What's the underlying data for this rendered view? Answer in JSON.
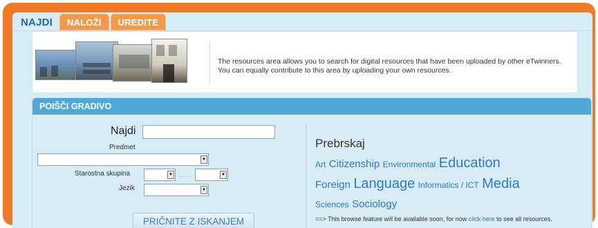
{
  "tabs": [
    {
      "label": "NAJDI",
      "active": true
    },
    {
      "label": "NALOŽI",
      "active": false
    },
    {
      "label": "UREDITE",
      "active": false
    }
  ],
  "info": {
    "line1": "The resources area allows you to search for digital resources that have been uploaded by other eTwinners.",
    "line2": "You can equally contribute to this area by uploading your own resources."
  },
  "search_panel": {
    "title": "POIŠČI GRADIVO",
    "find_label": "Najdi",
    "subject_label": "Predmet",
    "age_group_label": "Starostna skupina",
    "age_separator": ".....",
    "language_label": "Jezik",
    "search_button": "PRIČNITE Z ISKANJEM"
  },
  "browse": {
    "title": "Prebrskaj",
    "tags": [
      {
        "text": "Art",
        "size": "small"
      },
      {
        "text": "Citizenship",
        "size": "medium"
      },
      {
        "text": "Environmental",
        "size": "small"
      },
      {
        "text": "Education",
        "size": "large"
      },
      {
        "text": "Foreign",
        "size": "medium"
      },
      {
        "text": "Language",
        "size": "large"
      },
      {
        "text": "Informatics / ICT",
        "size": "small"
      },
      {
        "text": "Media",
        "size": "large"
      },
      {
        "text": "Sciences",
        "size": "small"
      },
      {
        "text": "Sociology",
        "size": "medium"
      }
    ],
    "note_prefix": "==> This browse feature will be available soon, for now",
    "note_link": "click here",
    "note_suffix": "to see all resources."
  },
  "colors": {
    "frame": "#ef7a28",
    "panel_bg": "#d8ecf5",
    "header": "#4fa8d6",
    "link": "#2a7bc8"
  },
  "icons": {
    "select_arrow": "chevron-down-icon"
  }
}
